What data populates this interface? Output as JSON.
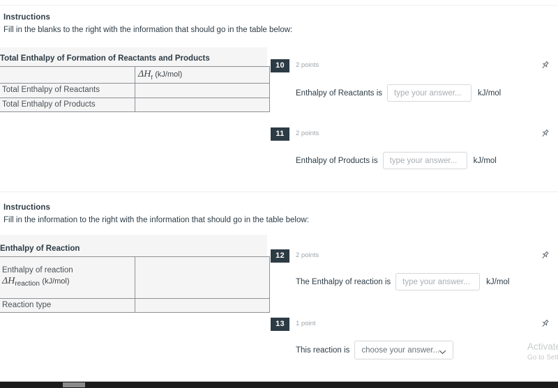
{
  "sections": [
    {
      "instructions_label": "Instructions",
      "instructions_text": "Fill in the blanks to the right with the information that should go in the table below:",
      "panel_title": "Total Enthalpy of Formation of Reactants and Products",
      "table": {
        "header_row": [
          "",
          "ΔH_f (kJ/mol)"
        ],
        "header_math": {
          "delta": "Δ",
          "symbol": "H",
          "sub": "f",
          "unit": "(kJ/mol)"
        },
        "rows": [
          {
            "label": "Total Enthalpy of Reactants",
            "value": ""
          },
          {
            "label": "Total Enthalpy of Products",
            "value": ""
          }
        ]
      },
      "questions": [
        {
          "number": "10",
          "points": "2 points",
          "prompt": "Enthalpy of Reactants is",
          "input_value": "",
          "input_placeholder": "type your answer...",
          "unit": "kJ/mol",
          "pin_icon": "pin-icon"
        },
        {
          "number": "11",
          "points": "2 points",
          "prompt": "Enthalpy of Products is",
          "input_value": "",
          "input_placeholder": "type your answer...",
          "unit": "kJ/mol",
          "pin_icon": "pin-icon"
        }
      ]
    },
    {
      "instructions_label": "Instructions",
      "instructions_text": "Fill in the information to the right with the information that should go in the table below:",
      "panel_title": "Enthalpy of Reaction",
      "table": {
        "rows": [
          {
            "label_line1": "Enthalpy of reaction",
            "label_math": {
              "delta": "Δ",
              "symbol": "H",
              "sub": "reaction",
              "unit": "(kJ/mol)"
            },
            "value": ""
          },
          {
            "label": "Reaction type",
            "value": ""
          }
        ]
      },
      "questions": [
        {
          "number": "12",
          "points": "2 points",
          "prompt": "The Enthalpy of reaction is",
          "input_value": "",
          "input_placeholder": "type your answer...",
          "unit": "kJ/mol",
          "pin_icon": "pin-icon"
        },
        {
          "number": "13",
          "points": "1 point",
          "prompt": "This reaction is",
          "select_value": "choose your answer...",
          "select_icon": "chevron-down-icon",
          "unit": "",
          "pin_icon": "pin-icon"
        }
      ]
    }
  ],
  "watermark": {
    "line1": "Activate Windows",
    "line2": "Go to Settings to activate Windows."
  },
  "colors": {
    "badge_bg": "#2d3b45",
    "panel_bg": "#f5f5f5",
    "text": "#2d3b45",
    "muted": "#9ea3a8",
    "border": "#d6d8da",
    "table_border": "#8d9094"
  }
}
